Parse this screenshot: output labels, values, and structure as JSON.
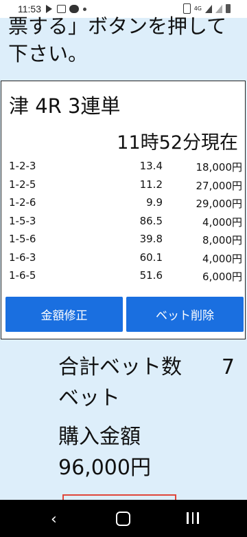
{
  "statusbar": {
    "time": "11:53"
  },
  "instruction": {
    "line1": "票する」ボタンを押して",
    "line2": "下さい。"
  },
  "race": {
    "title": "津 4R 3連単",
    "as_of": "11時52分現在"
  },
  "bets": [
    {
      "combo": "1-2-3",
      "odds": "13.4",
      "amount": "18,000円"
    },
    {
      "combo": "1-2-5",
      "odds": "11.2",
      "amount": "27,000円"
    },
    {
      "combo": "1-2-6",
      "odds": "9.9",
      "amount": "29,000円"
    },
    {
      "combo": "1-5-3",
      "odds": "86.5",
      "amount": "4,000円"
    },
    {
      "combo": "1-5-6",
      "odds": "39.8",
      "amount": "8,000円"
    },
    {
      "combo": "1-6-3",
      "odds": "60.1",
      "amount": "4,000円"
    },
    {
      "combo": "1-6-5",
      "odds": "51.6",
      "amount": "6,000円"
    }
  ],
  "buttons": {
    "edit_amount": "金額修正",
    "delete_bet": "ベット削除"
  },
  "totals": {
    "bet_count_label": "合計ベット数",
    "bet_count_value": "7",
    "bet_unit": "ベット",
    "purchase_label": "購入金額",
    "purchase_value": "96,000円"
  },
  "colors": {
    "background": "#ddeefa",
    "button_blue": "#1a6fe0",
    "accent_red": "#e0463a"
  },
  "icons": [
    "play-store-icon",
    "gallery-icon",
    "messenger-icon",
    "notification-dot-icon",
    "battery-icon",
    "signal-icon",
    "wifi-icon",
    "back-icon",
    "home-icon",
    "recent-apps-icon"
  ]
}
